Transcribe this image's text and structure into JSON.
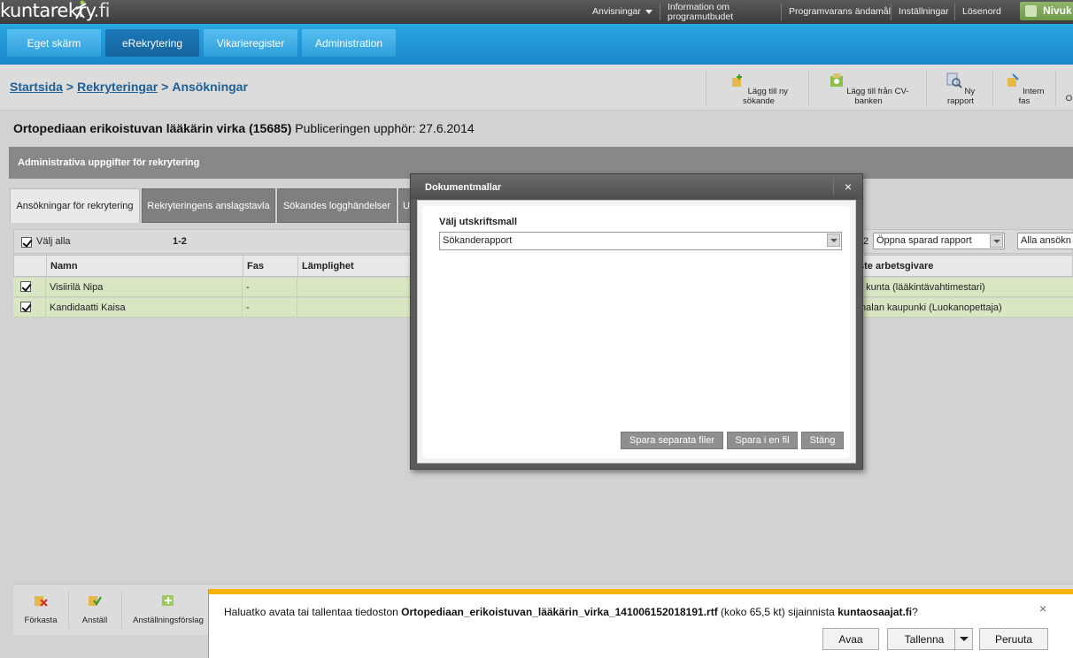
{
  "app": {
    "logo_text": "kuntarekry",
    "logo_suffix": ".fi"
  },
  "toplinks": {
    "annotations": "Anvisningar",
    "info_line1": "Information om",
    "info_line2": "programutbudet",
    "purpose": "Programvarans ändamål",
    "settings": "Inställningar",
    "password": "Lösenord",
    "user": "Nivuk"
  },
  "nav": {
    "tabs": [
      {
        "label": "Eget skärm"
      },
      {
        "label": "eRekrytering"
      },
      {
        "label": "Vikarieregister"
      },
      {
        "label": "Administration"
      }
    ]
  },
  "breadcrumb": {
    "home": "Startsida",
    "sep": ">",
    "recruitments": "Rekryteringar",
    "current": "Ansökningar"
  },
  "toolbar": {
    "add_applicant": "Lägg till ny sökande",
    "add_from_cv": "Lägg till från CV-banken",
    "new_report": "Ny rapport",
    "internal_phase": "Intern fas",
    "more": "O"
  },
  "job": {
    "title": "Ortopediaan erikoistuvan lääkärin virka (15685)",
    "published": "Publiceringen upphör: 27.6.2014"
  },
  "section": {
    "title": "Administrativa uppgifter för rekrytering"
  },
  "subtabs": [
    {
      "label": "Ansökningar för rekrytering"
    },
    {
      "label": "Rekryteringens anslagstavla"
    },
    {
      "label": "Sökandes logghändelser"
    },
    {
      "label": "U"
    }
  ],
  "grid": {
    "select_all": "Välj alla",
    "range": "1-2",
    "count_tail": "2",
    "saved_report": "Öppna sparad rapport",
    "all_applicants": "Alla ansökn",
    "columns": {
      "name": "Namn",
      "phase": "Fas",
      "suitability": "Lämplighet",
      "employer": "ste arbetsgivare"
    },
    "rows": [
      {
        "name": "Visiirilä Nipa",
        "phase": "-",
        "employer": "n kunta (lääkintävahtimestari)"
      },
      {
        "name": "Kandidaatti Kaisa",
        "phase": "-",
        "employer": "malan kaupunki (Luokanopettaja)"
      }
    ]
  },
  "bottom": {
    "reject": "Förkasta",
    "hire": "Anställ",
    "hire_proposal": "Anställningsförslag"
  },
  "modal": {
    "title": "Dokumentmallar",
    "close": "×",
    "label": "Välj utskriftsmall",
    "selected": "Sökanderapport",
    "btn_separate": "Spara separata filer",
    "btn_single": "Spara i en fil",
    "btn_close": "Stäng"
  },
  "download": {
    "prefix": "Haluatko avata tai tallentaa tiedoston ",
    "filename": "Ortopediaan_erikoistuvan_lääkärin_virka_141006152018191.rtf",
    "middle": " (koko 65,5 kt) sijainnista ",
    "site": "kuntaosaajat.fi",
    "suffix": "?",
    "open": "Avaa",
    "save": "Tallenna",
    "cancel": "Peruuta",
    "close": "×"
  },
  "colors": {
    "nav_blue": "#1b86c9",
    "row_green": "#d9e6c4",
    "download_accent": "#f4b400"
  }
}
